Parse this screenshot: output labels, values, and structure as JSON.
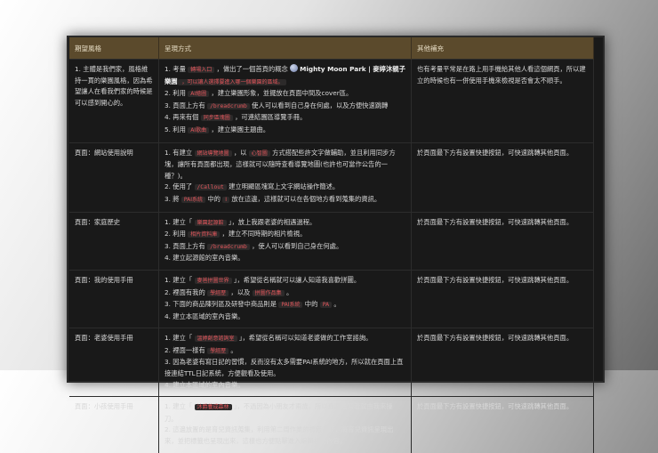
{
  "headers": [
    "期望風格",
    "呈現方式",
    "其他補充"
  ],
  "rows": [
    {
      "style": "1. 主體是我們家，風格維持一貫的樂園風格，因為希望讓人在看我們家的時候是可以感到開心的。",
      "method": [
        [
          "1. 考量 ",
          "轉場入口",
          " ，做出了一個首頁的概念 ",
          "",
          "Mighty Moon Park | 麥婷沐親子樂園",
          " ，可以讓人選擇要進入哪一個樂園的區域。"
        ],
        [
          "2. 利用 ",
          "AI繪圖",
          " ，建立樂園形象，並擺放在頁面中間及cover區。"
        ],
        [
          "3. 頁面上方有 ",
          "/breadcrumb",
          " 使人可以看到自己身在何處，以及方便快速跳轉"
        ],
        [
          "4. 再來有個 ",
          "同步區塊圖",
          " ，可連結園區導覽手冊。"
        ],
        [
          "5. 利用 ",
          "AI歌曲",
          " ，建立樂園主題曲。"
        ]
      ],
      "note": "也有考量平常是在路上用手機給其他人看這個網頁，所以建立的時候也有一併使用手機來檢視是否會太不順手。"
    },
    {
      "style": "頁面：網站使用說明",
      "method": [
        [
          "1. 有建立 ",
          "網站導覽地圖",
          " ，以 ",
          "心智圖",
          " 方式搭配些許文字做輔助，並且利用同步方塊，讓所有頁面都出現，這樣就可以隨時查看導覽地圖(也許也可當作公告的一種？)。"
        ],
        [
          "2. 使用了 ",
          "/Callout",
          " 建立明顯區塊寫上文字網站操作簡述。"
        ],
        [
          "3. 將 ",
          "PAI系統",
          " 中的 ",
          "I",
          " 放在這邊，這樣就可以在各個地方看到蒐集的資訊。"
        ]
      ],
      "note": "於頁面最下方有設置快捷按鈕，可快速跳轉其他頁面。"
    },
    {
      "style": "頁面：家庭歷史",
      "method": [
        [
          "1. 建立「 ",
          "樂園起源館",
          " 」，放上我跟老婆的相遇過程。"
        ],
        [
          "2. 利用 ",
          "相片資料庫",
          " ，建立不同時期的相片檢視。"
        ],
        [
          "3. 頁面上方有 ",
          "/breadcrumb",
          " ，使人可以看到自己身在何處。"
        ],
        [
          "4. 建立起源館的室內音樂。"
        ]
      ],
      "note": "於頁面最下方有設置快捷按鈕，可快速跳轉其他頁面。"
    },
    {
      "style": "頁面：我的使用手冊",
      "method": [
        [
          "1. 建立「 ",
          "麥爸拼圖世界",
          " 」，希望從名稱就可以讓人知道我喜歡拼圖。"
        ],
        [
          "2. 裡面有我的 ",
          "學經歷",
          " ，以及 ",
          "拼圖作品集",
          " 。"
        ],
        [
          "3. 下面的商品陳列區及研發中商品則是 ",
          "PAI系統",
          " 中的 ",
          "PA",
          " 。"
        ],
        [
          "4. 建立本區域的室內音樂。"
        ]
      ],
      "note": "於頁面最下方有設置快捷按鈕，可快速跳轉其他頁面。"
    },
    {
      "style": "頁面：老婆使用手冊",
      "method": [
        [
          "1. 建立「 ",
          "溫婷創意諮詢室",
          " 」，希望從名稱可以知道老婆做的工作室諮詢。"
        ],
        [
          "2. 裡面一樣有 ",
          "學經歷",
          " 。"
        ],
        [
          "3. 因為老婆有寫日記的習慣，反而沒有太多需要PAI系統的地方，所以就在頁面上直接連結TTL日記系統，方便觀看及使用。"
        ],
        [
          "4. 建立本區域的室內音樂。"
        ]
      ],
      "note": "於頁面最下方有設置快捷按鈕，可快速跳轉其他頁面。"
    },
    {
      "style": "頁面：小孩使用手冊",
      "method": [
        [
          "1. 建立「 ",
          "沐爵養成森林",
          " 」，不過因為小朋友才兩歲，所以頁面撰寫者就由我來操刀。"
        ],
        [
          "2. 這邊放置的是育兒資訊蒐集，利用第二周作業的標籤系統，將育兒資訊呈現出來，並把標籤也呈現出來，這樣也方便點擊進入編輯標籤內容。"
        ]
      ],
      "note": "於頁面最下方有設置快捷按鈕，可快速跳轉其他頁面。"
    }
  ]
}
